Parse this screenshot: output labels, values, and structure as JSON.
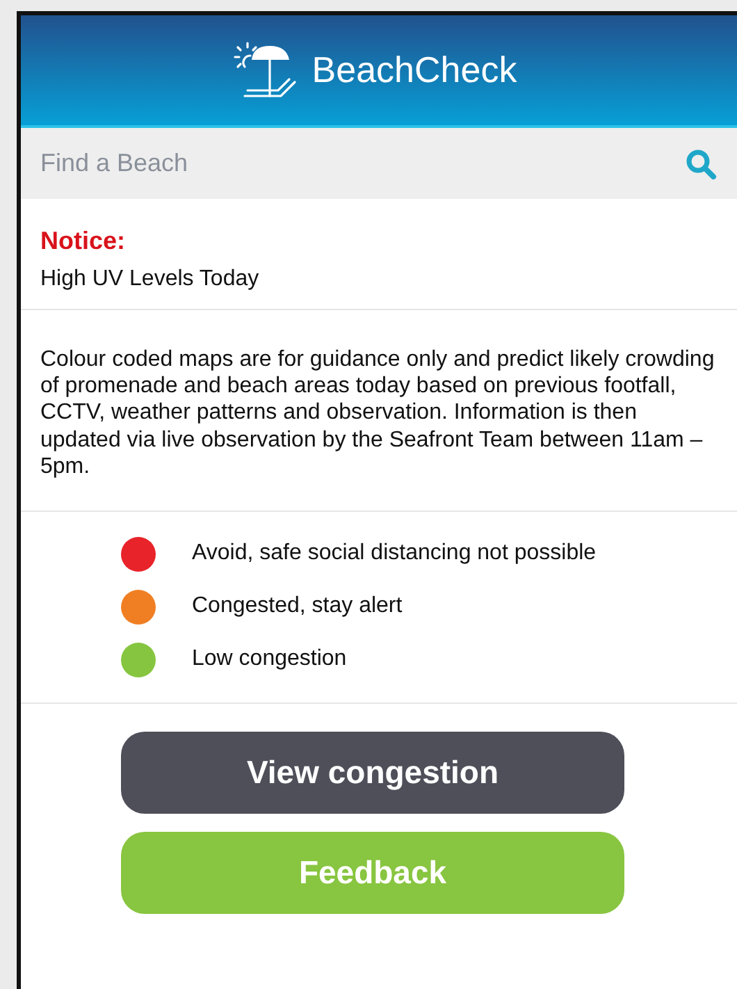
{
  "app": {
    "title": "BeachCheck"
  },
  "search": {
    "placeholder": "Find a Beach"
  },
  "notice": {
    "heading": "Notice:",
    "text": "High UV Levels Today"
  },
  "info": "Colour coded maps are for guidance only and predict likely crowding of promenade and beach areas today based on previous footfall, CCTV, weather patterns and observation. Information is then updated via live observation by the Seafront Team between 11am – 5pm.",
  "legend": [
    {
      "label": "Avoid, safe social distancing not possible",
      "color": "#e8232a"
    },
    {
      "label": "Congested, stay alert",
      "color": "#f07f23"
    },
    {
      "label": "Low congestion",
      "color": "#86c53f"
    }
  ],
  "buttons": [
    {
      "label": "View congestion",
      "kind": "dark"
    },
    {
      "label": "Feedback",
      "kind": "green"
    }
  ]
}
